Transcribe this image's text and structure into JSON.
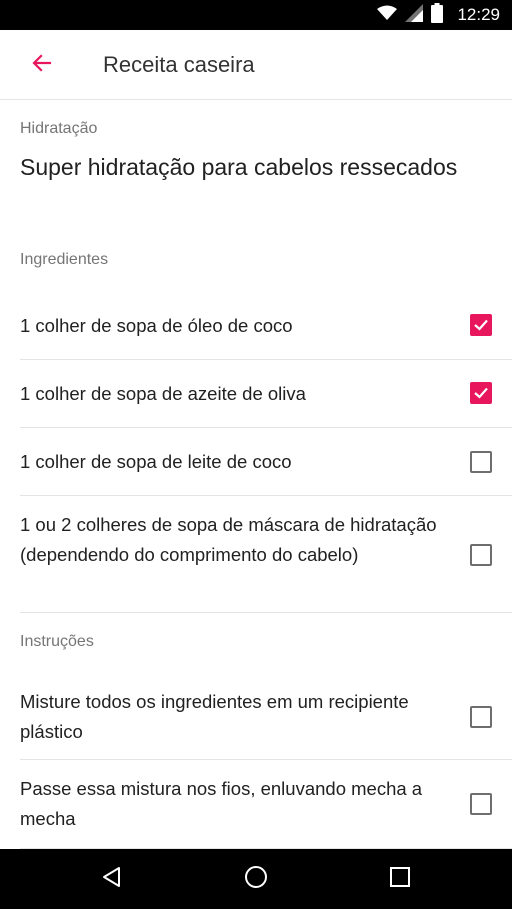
{
  "status_bar": {
    "time": "12:29",
    "icons": [
      "wifi-icon",
      "signal-icon",
      "battery-icon"
    ]
  },
  "app_bar": {
    "back_icon": "arrow-left-icon",
    "title": "Receita caseira"
  },
  "recipe": {
    "category": "Hidratação",
    "title": "Super hidratação para cabelos ressecados"
  },
  "ingredients": {
    "header": "Ingredientes",
    "items": [
      {
        "text": "1 colher de sopa de óleo de coco",
        "checked": true
      },
      {
        "text": "1 colher de sopa de azeite de oliva",
        "checked": true
      },
      {
        "text": "1 colher de sopa de leite de coco",
        "checked": false
      },
      {
        "text": "1 ou 2 colheres de sopa de máscara de hidratação (dependendo do comprimento do cabelo)",
        "checked": false
      }
    ]
  },
  "instructions": {
    "header": "Instruções",
    "items": [
      {
        "text": "Misture todos os ingredientes em um recipiente plástico",
        "checked": false
      },
      {
        "text": "Passe essa mistura nos fios, enluvando mecha a mecha",
        "checked": false
      }
    ]
  },
  "nav_bar": {
    "icons": [
      "back-triangle-icon",
      "home-circle-icon",
      "recents-square-icon"
    ]
  },
  "colors": {
    "accent": "#e8175d",
    "text_primary": "#212121",
    "text_secondary": "#757575",
    "divider": "#e4e4e4"
  }
}
